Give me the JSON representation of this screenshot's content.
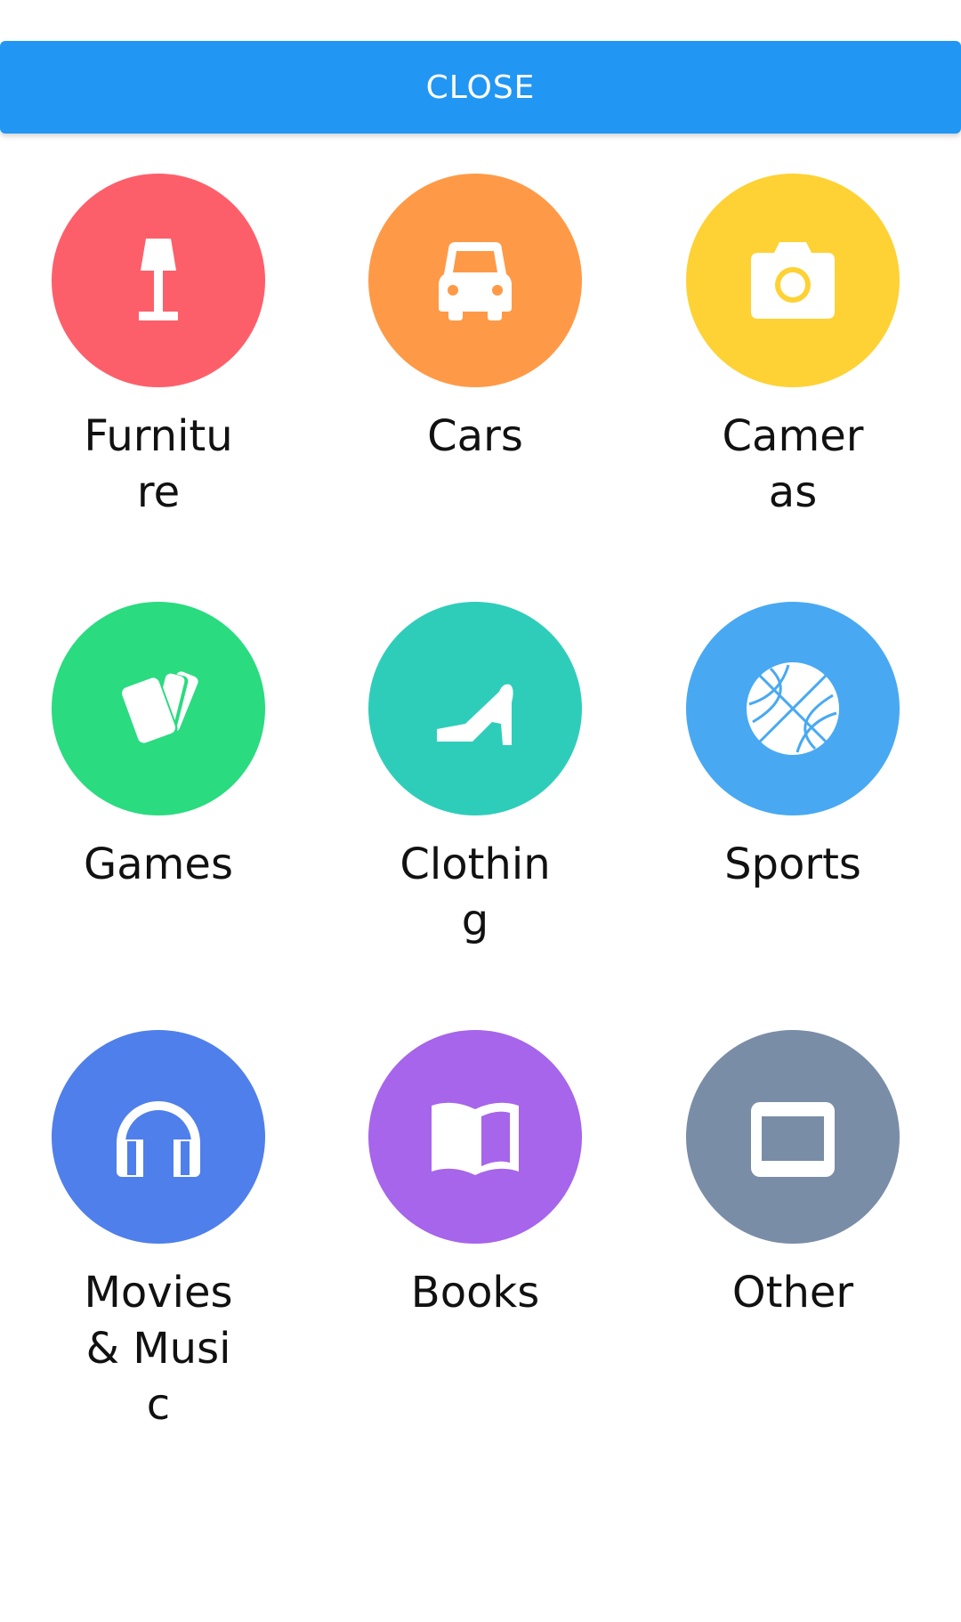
{
  "header": {
    "close_label": "CLOSE",
    "color": "#2196f3"
  },
  "categories": [
    {
      "label": "Furniture",
      "icon": "lamp-icon",
      "color": "#fd5f6a"
    },
    {
      "label": "Cars",
      "icon": "car-icon",
      "color": "#fe9a47"
    },
    {
      "label": "Cameras",
      "icon": "camera-icon",
      "color": "#fed235"
    },
    {
      "label": "Games",
      "icon": "cards-icon",
      "color": "#2adb80"
    },
    {
      "label": "Clothing",
      "icon": "high-heel-icon",
      "color": "#2ecdba"
    },
    {
      "label": "Sports",
      "icon": "basketball-icon",
      "color": "#48a9f2"
    },
    {
      "label": "Movies & Music",
      "icon": "headphones-icon",
      "color": "#4f7feb"
    },
    {
      "label": "Books",
      "icon": "book-icon",
      "color": "#a665ea"
    },
    {
      "label": "Other",
      "icon": "window-icon",
      "color": "#7a8da7"
    }
  ]
}
